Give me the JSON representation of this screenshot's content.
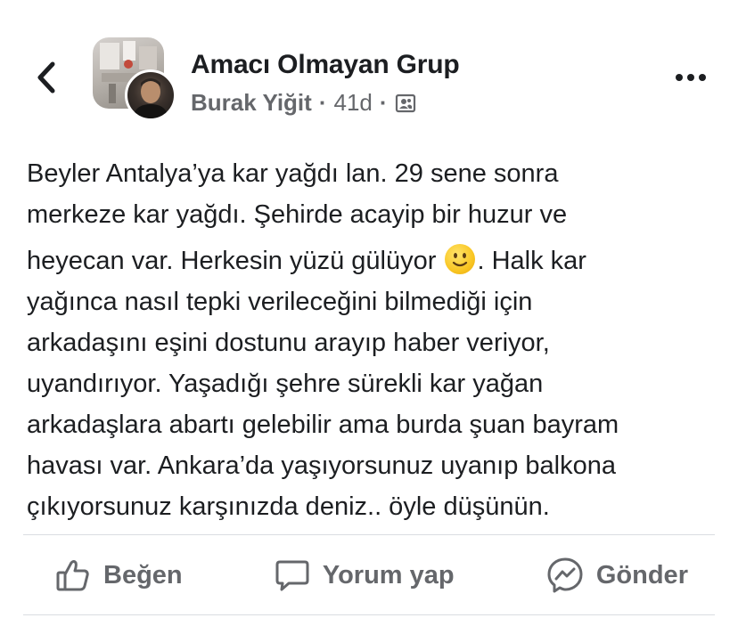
{
  "header": {
    "back_icon": "chevron-left-icon",
    "group_name": "Amacı Olmayan Grup",
    "author": "Burak Yiğit",
    "separator": "·",
    "time": "41d",
    "audience_icon": "group-privacy-icon",
    "more_icon": "more-horizontal-icon"
  },
  "post": {
    "lines": [
      "Beyler Antalya’ya kar yağdı lan. 29 sene sonra",
      "merkeze kar yağdı. Şehirde acayip bir huzur ve",
      "heyecan var. Herkesin yüzü gülüyor",
      ". Halk kar",
      "yağınca nasıl tepki verileceğini bilmediği için",
      "arkadaşını eşini dostunu arayıp haber veriyor,",
      "uyandırıyor. Yaşadığı şehre sürekli kar yağan",
      "arkadaşlara abartı gelebilir ama burda şuan bayram",
      "havası var. Ankara’da yaşıyorsunuz uyanıp balkona",
      "çıkıyorsunuz karşınızda deniz.. öyle düşünün."
    ],
    "emoji": "slightly-smiling-face-icon"
  },
  "actions": {
    "like_label": "Beğen",
    "comment_label": "Yorum yap",
    "send_label": "Gönder"
  },
  "colors": {
    "text": "#1c1e21",
    "secondary_text": "#65676b",
    "divider": "#dadde1",
    "background": "#ffffff"
  }
}
